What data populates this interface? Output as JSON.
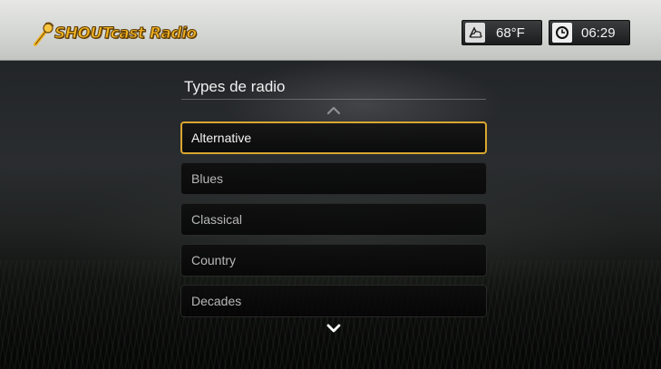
{
  "header": {
    "app_logo_text": "SHOUTcast Radio",
    "weather": {
      "icon": "weather-cloud-sun-icon",
      "temperature": "68°F"
    },
    "clock": {
      "icon": "clock-icon",
      "time": "06:29"
    }
  },
  "menu": {
    "title": "Types de radio",
    "items": [
      {
        "label": "Alternative",
        "selected": true
      },
      {
        "label": "Blues",
        "selected": false
      },
      {
        "label": "Classical",
        "selected": false
      },
      {
        "label": "Country",
        "selected": false
      },
      {
        "label": "Decades",
        "selected": false
      }
    ]
  },
  "colors": {
    "selection_border": "#d8a630",
    "logo_gold": "#f2b321"
  }
}
